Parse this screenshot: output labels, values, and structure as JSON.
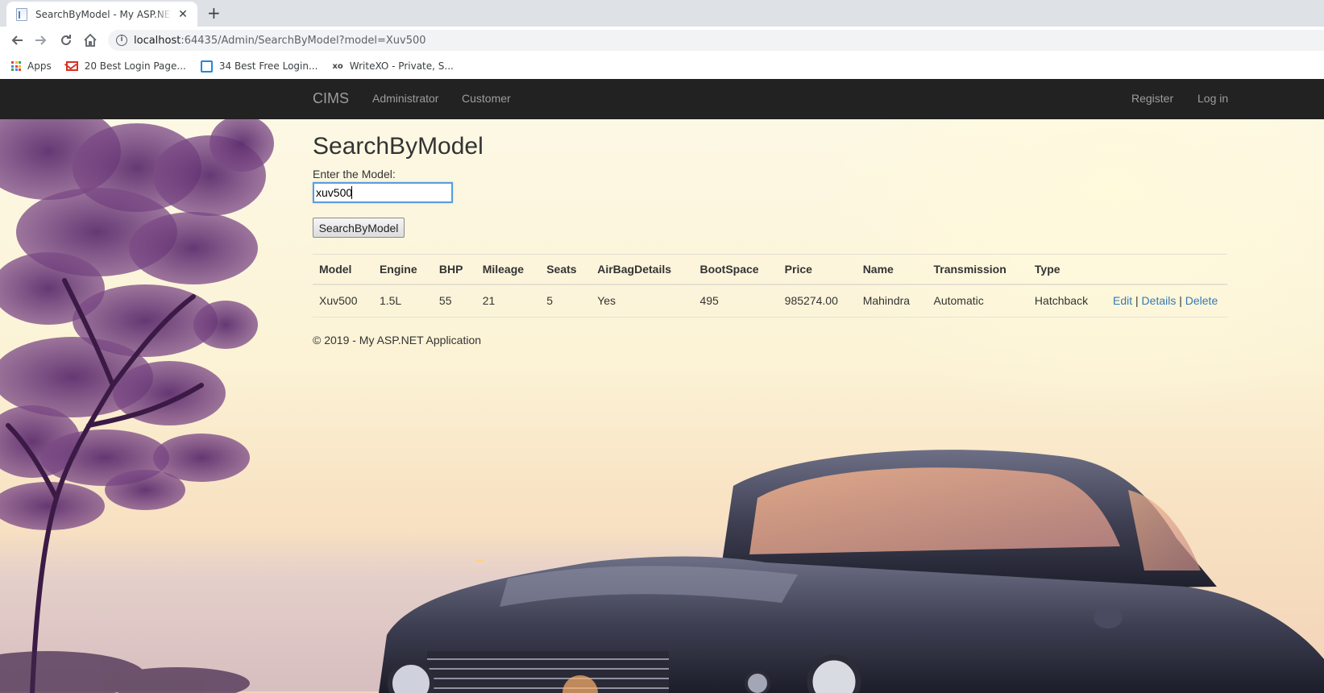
{
  "browser": {
    "tab_title": "SearchByModel - My ASP.NET Application",
    "new_tab_label": "+",
    "close_label": "✕",
    "url_host": "localhost",
    "url_path": ":64435/Admin/SearchByModel?model=Xuv500",
    "bookmarks": [
      {
        "label": "Apps",
        "icon": "apps-grid-icon"
      },
      {
        "label": "20 Best Login Page...",
        "icon": "gmail-icon"
      },
      {
        "label": "34 Best Free Login...",
        "icon": "blue-square-icon"
      },
      {
        "label": "WriteXO - Private, S...",
        "icon": "xo-icon",
        "icon_text": "xo"
      }
    ]
  },
  "navbar": {
    "brand": "CIMS",
    "links": [
      "Administrator",
      "Customer"
    ],
    "right_links": [
      "Register",
      "Log in"
    ]
  },
  "page": {
    "title": "SearchByModel",
    "field_label": "Enter the Model:",
    "input_value": "xuv500",
    "button_label": "SearchByModel"
  },
  "table": {
    "headers": [
      "Model",
      "Engine",
      "BHP",
      "Mileage",
      "Seats",
      "AirBagDetails",
      "BootSpace",
      "Price",
      "Name",
      "Transmission",
      "Type",
      ""
    ],
    "rows": [
      {
        "cells": [
          "Xuv500",
          "1.5L",
          "55",
          "21",
          "5",
          "Yes",
          "495",
          "985274.00",
          "Mahindra",
          "Automatic",
          "Hatchback"
        ],
        "actions": [
          "Edit",
          "Details",
          "Delete"
        ],
        "separator": "|"
      }
    ]
  },
  "footer": "© 2019 - My ASP.NET Application",
  "colors": {
    "navbar_bg": "#222222",
    "navbar_text": "#9d9d9d",
    "link": "#337ab7",
    "input_focus_border": "#5b9dd9"
  }
}
